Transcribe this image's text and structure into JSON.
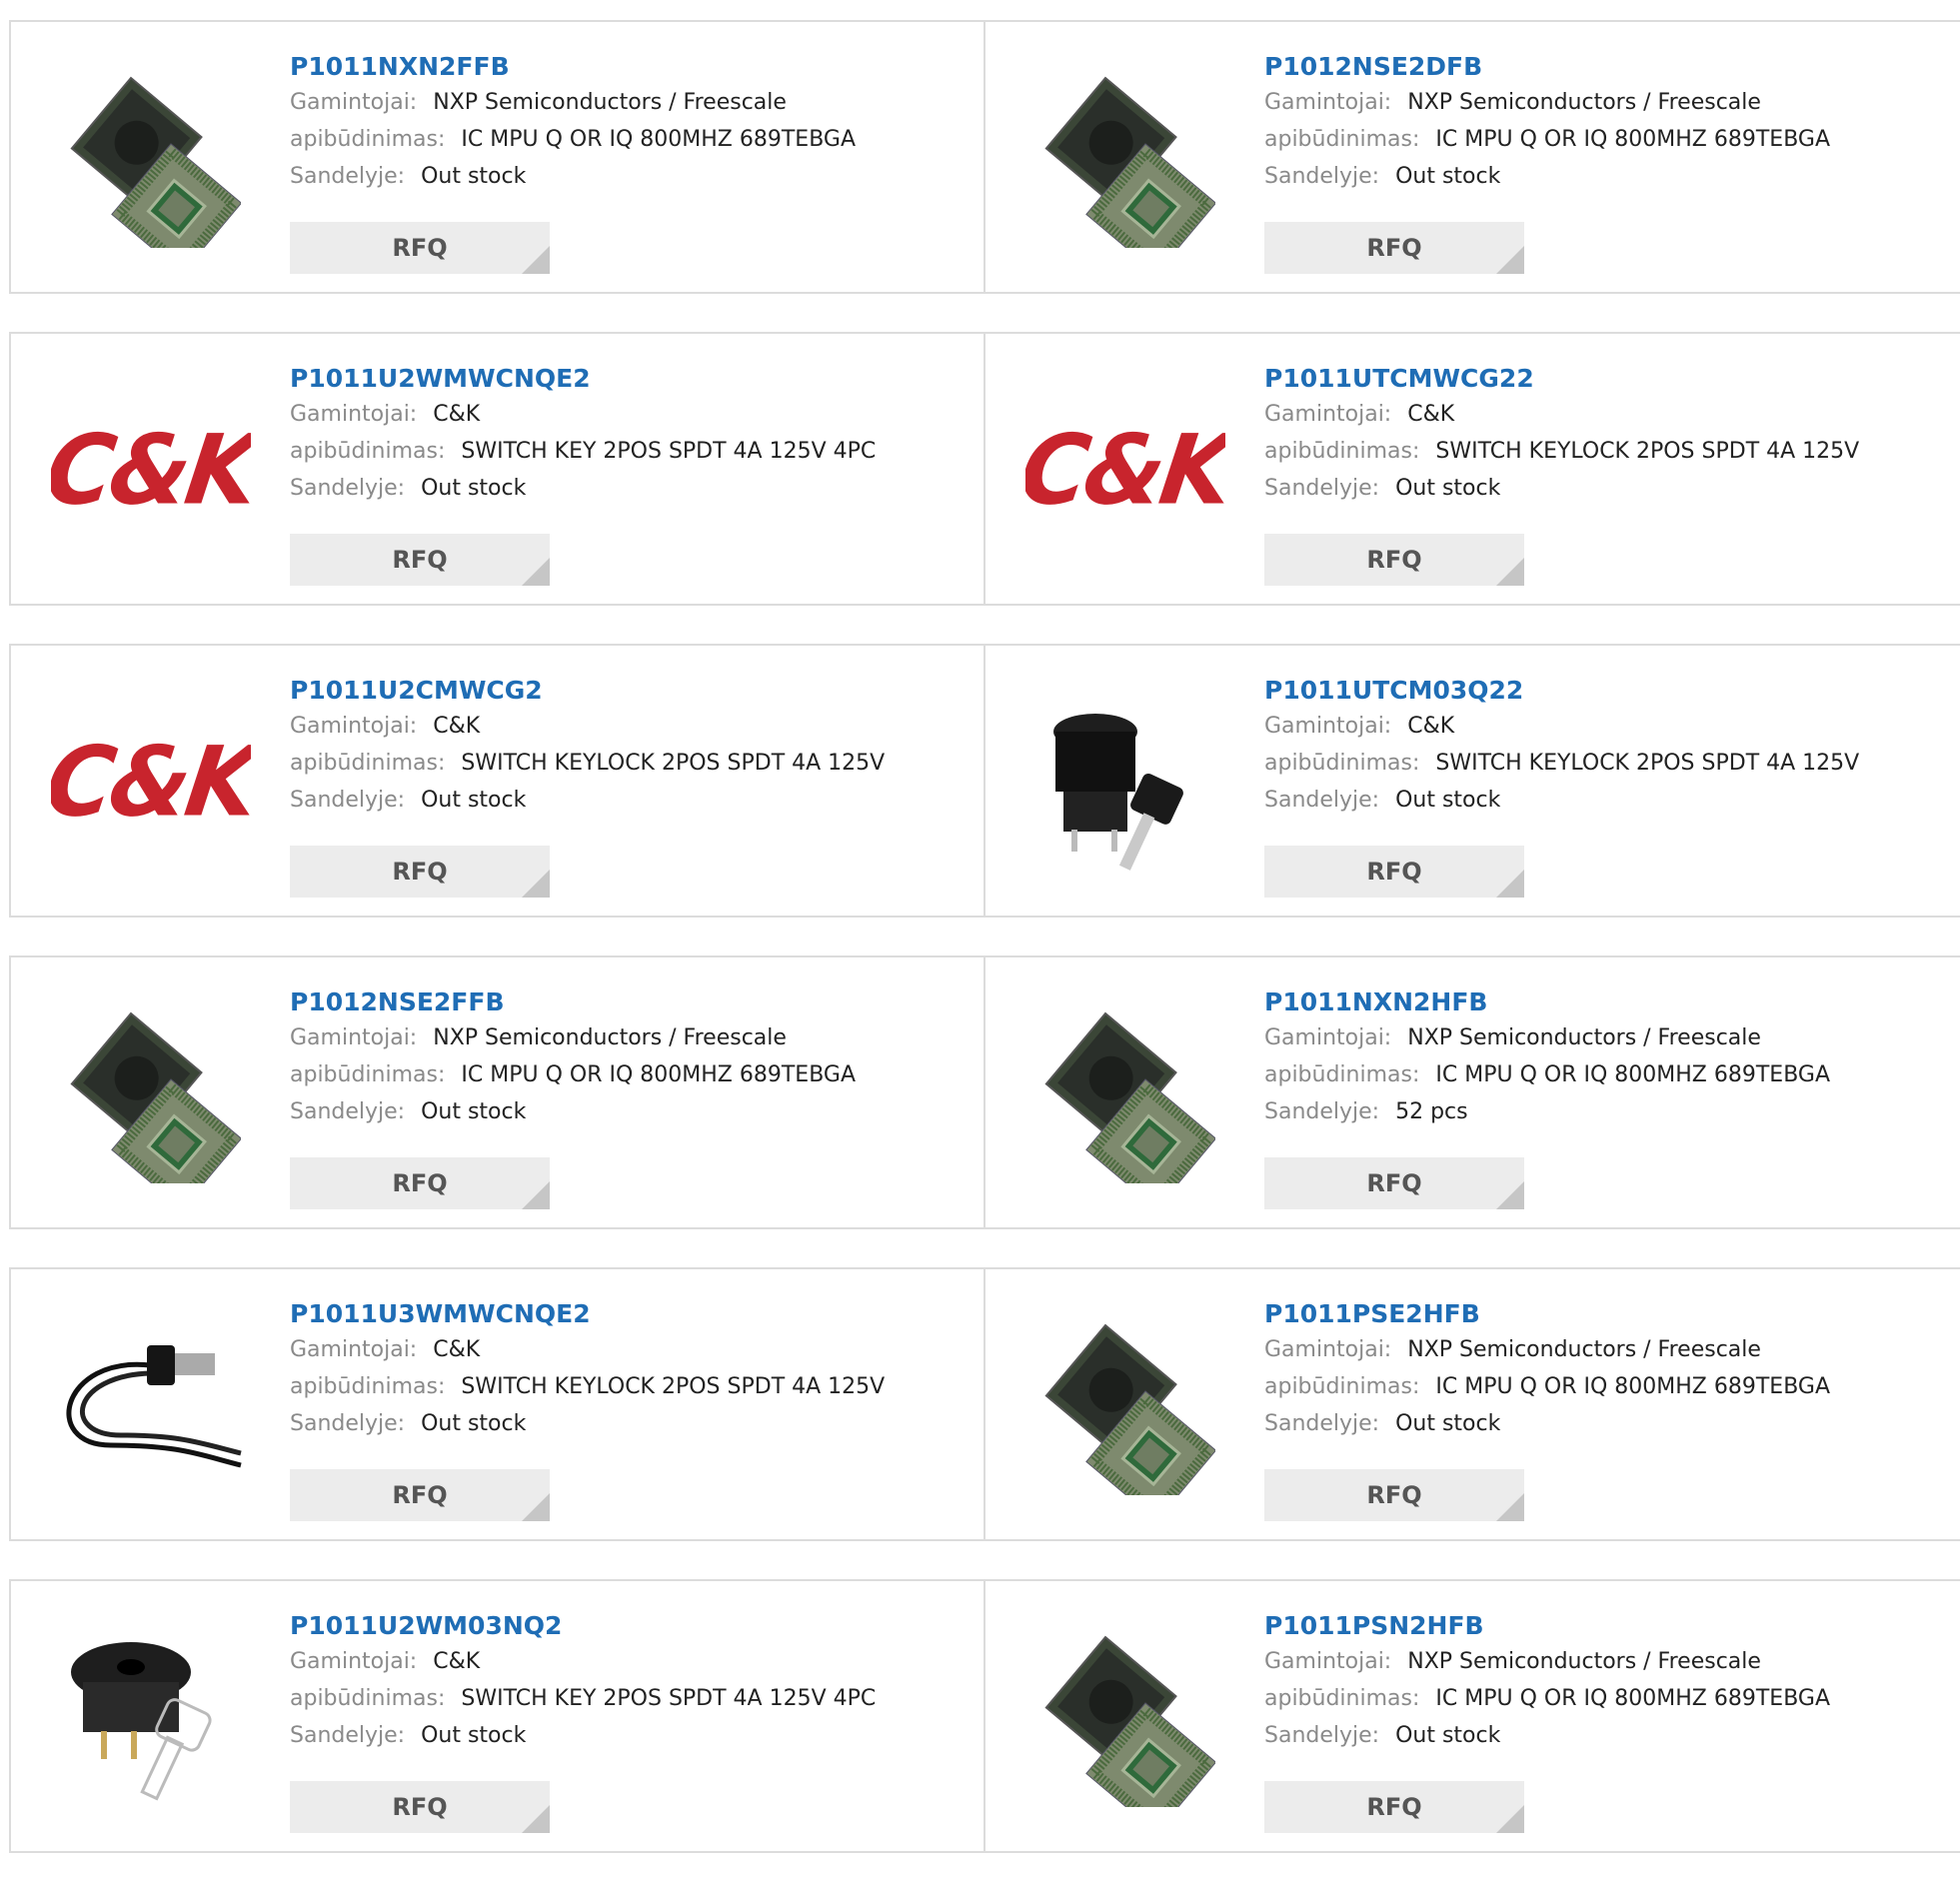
{
  "labels": {
    "manufacturer": "Gamintojai:",
    "description": "apibūdinimas:",
    "stock": "Sandelyje:",
    "rfq": "RFQ"
  },
  "products": [
    {
      "pn": "P1011NXN2FFB",
      "manufacturer": "NXP Semiconductors / Freescale",
      "description": "IC MPU Q OR IQ 800MHZ 689TEBGA",
      "stock": "Out stock",
      "image": "bga-chip"
    },
    {
      "pn": "P1012NSE2DFB",
      "manufacturer": "NXP Semiconductors / Freescale",
      "description": "IC MPU Q OR IQ 800MHZ 689TEBGA",
      "stock": "Out stock",
      "image": "bga-chip"
    },
    {
      "pn": "P1011U2WMWCNQE2",
      "manufacturer": "C&K",
      "description": "SWITCH KEY 2POS SPDT 4A 125V 4PC",
      "stock": "Out stock",
      "image": "ck-logo"
    },
    {
      "pn": "P1011UTCMWCG22",
      "manufacturer": "C&K",
      "description": "SWITCH KEYLOCK 2POS SPDT 4A 125V",
      "stock": "Out stock",
      "image": "ck-logo"
    },
    {
      "pn": "P1011U2CMWCG2",
      "manufacturer": "C&K",
      "description": "SWITCH KEYLOCK 2POS SPDT 4A 125V",
      "stock": "Out stock",
      "image": "ck-logo"
    },
    {
      "pn": "P1011UTCM03Q22",
      "manufacturer": "C&K",
      "description": "SWITCH KEYLOCK 2POS SPDT 4A 125V",
      "stock": "Out stock",
      "image": "keylock-switch"
    },
    {
      "pn": "P1012NSE2FFB",
      "manufacturer": "NXP Semiconductors / Freescale",
      "description": "IC MPU Q OR IQ 800MHZ 689TEBGA",
      "stock": "Out stock",
      "image": "bga-chip"
    },
    {
      "pn": "P1011NXN2HFB",
      "manufacturer": "NXP Semiconductors / Freescale",
      "description": "IC MPU Q OR IQ 800MHZ 689TEBGA",
      "stock": "52 pcs",
      "image": "bga-chip"
    },
    {
      "pn": "P1011U3WMWCNQE2",
      "manufacturer": "C&K",
      "description": "SWITCH KEYLOCK 2POS SPDT 4A 125V",
      "stock": "Out stock",
      "image": "wired-switch"
    },
    {
      "pn": "P1011PSE2HFB",
      "manufacturer": "NXP Semiconductors / Freescale",
      "description": "IC MPU Q OR IQ 800MHZ 689TEBGA",
      "stock": "Out stock",
      "image": "bga-chip"
    },
    {
      "pn": "P1011U2WM03NQ2",
      "manufacturer": "C&K",
      "description": "SWITCH KEY 2POS SPDT 4A 125V 4PC",
      "stock": "Out stock",
      "image": "key-switch"
    },
    {
      "pn": "P1011PSN2HFB",
      "manufacturer": "NXP Semiconductors / Freescale",
      "description": "IC MPU Q OR IQ 800MHZ 689TEBGA",
      "stock": "Out stock",
      "image": "bga-chip"
    }
  ],
  "logo_text": "C&K",
  "colors": {
    "link": "#1f6db5",
    "brand_ck": "#c8242d",
    "label": "#8a8a8a"
  }
}
